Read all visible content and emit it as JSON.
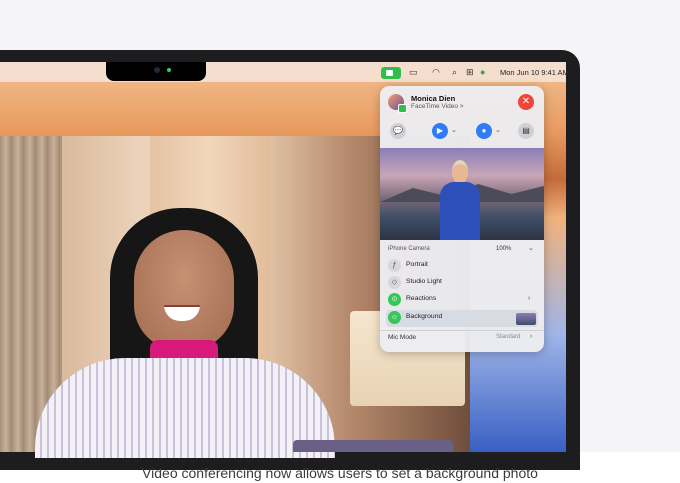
{
  "menubar": {
    "datetime": "Mon Jun 10  9:41 AM"
  },
  "call": {
    "name": "Monica Dien",
    "subtitle": "FaceTime Video >",
    "end_symbol": "✕"
  },
  "effects": {
    "camera_label": "iPhone Camera",
    "battery": "100%",
    "items": [
      {
        "label": "Portrait",
        "icon": "f-icon"
      },
      {
        "label": "Studio Light",
        "icon": "cube-icon"
      },
      {
        "label": "Reactions",
        "icon": "reactions-icon"
      },
      {
        "label": "Background",
        "icon": "background-icon"
      }
    ],
    "mic_mode_label": "Mic Mode",
    "mic_mode_value": "Standard"
  },
  "caption": "Video conferencing now allows users to set a background photo"
}
